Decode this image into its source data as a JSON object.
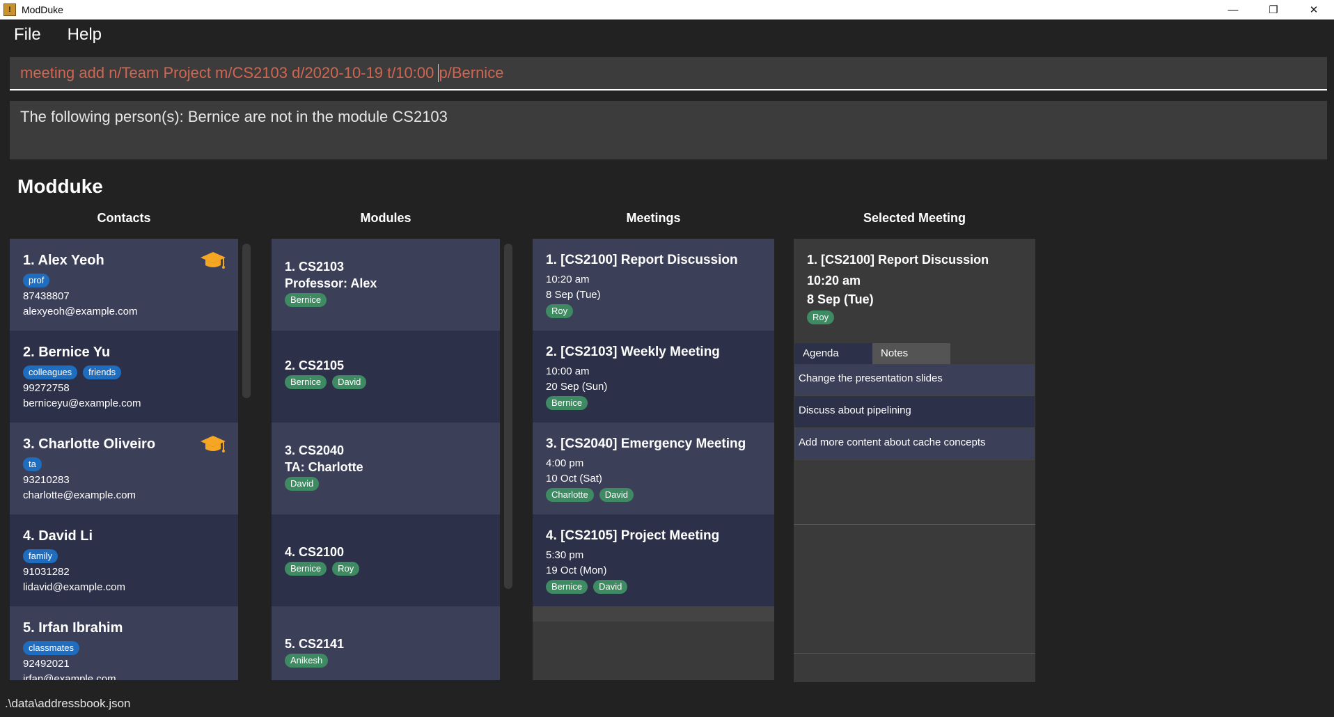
{
  "window": {
    "title": "ModDuke",
    "icon_letter": "!",
    "controls": {
      "minimize": "—",
      "maximize": "❐",
      "close": "✕"
    }
  },
  "menu": {
    "file": "File",
    "help": "Help"
  },
  "command": {
    "before_caret": "meeting add n/Team Project m/CS2103 d/2020-10-19 t/10:00 ",
    "after_caret": "p/Bernice"
  },
  "result": "The following person(s): Bernice are not in the module CS2103",
  "app_heading": "Modduke",
  "headers": {
    "contacts": "Contacts",
    "modules": "Modules",
    "meetings": "Meetings",
    "selected": "Selected Meeting"
  },
  "contacts": [
    {
      "name": "1.  Alex Yeoh",
      "tags": [
        "prof"
      ],
      "phone": "87438807",
      "email": "alexyeoh@example.com",
      "grad": true
    },
    {
      "name": "2.  Bernice Yu",
      "tags": [
        "colleagues",
        "friends"
      ],
      "phone": "99272758",
      "email": "berniceyu@example.com",
      "grad": false
    },
    {
      "name": "3.  Charlotte Oliveiro",
      "tags": [
        "ta"
      ],
      "phone": "93210283",
      "email": "charlotte@example.com",
      "grad": true
    },
    {
      "name": "4.  David Li",
      "tags": [
        "family"
      ],
      "phone": "91031282",
      "email": "lidavid@example.com",
      "grad": false
    },
    {
      "name": "5.  Irfan Ibrahim",
      "tags": [
        "classmates"
      ],
      "phone": "92492021",
      "email": "irfan@example.com",
      "grad": false
    }
  ],
  "modules": [
    {
      "name": "1.  CS2103",
      "role": "Professor: Alex",
      "tags": [
        "Bernice"
      ]
    },
    {
      "name": "2.  CS2105",
      "role": "",
      "tags": [
        "Bernice",
        "David"
      ]
    },
    {
      "name": "3.  CS2040",
      "role": "TA: Charlotte",
      "tags": [
        "David"
      ]
    },
    {
      "name": "4.  CS2100",
      "role": "",
      "tags": [
        "Bernice",
        "Roy"
      ]
    },
    {
      "name": "5.  CS2141",
      "role": "",
      "tags": [
        "Anikesh"
      ]
    }
  ],
  "meetings": [
    {
      "name": "1.  [CS2100] Report Discussion",
      "time": "10:20 am",
      "date": "8 Sep (Tue)",
      "tags": [
        "Roy"
      ]
    },
    {
      "name": "2.  [CS2103] Weekly Meeting",
      "time": "10:00 am",
      "date": "20 Sep (Sun)",
      "tags": [
        "Bernice"
      ]
    },
    {
      "name": "3.  [CS2040] Emergency Meeting",
      "time": "4:00 pm",
      "date": "10 Oct (Sat)",
      "tags": [
        "Charlotte",
        "David"
      ]
    },
    {
      "name": "4.  [CS2105] Project Meeting",
      "time": "5:30 pm",
      "date": "19 Oct (Mon)",
      "tags": [
        "Bernice",
        "David"
      ]
    }
  ],
  "selected_meeting": {
    "name": "1.  [CS2100] Report Discussion",
    "time": "10:20 am",
    "date": "8 Sep (Tue)",
    "tags": [
      "Roy"
    ],
    "tabs": [
      "Agenda",
      "Notes"
    ],
    "agenda": [
      "Change the presentation slides",
      "Discuss about pipelining",
      "Add more content about cache concepts"
    ]
  },
  "status": ".\\data\\addressbook.json",
  "colors": {
    "accent_command": "#d06651",
    "tag_blue": "#1f6dbf",
    "tag_green": "#3e8a62",
    "grad_cap": "#f5a623"
  }
}
